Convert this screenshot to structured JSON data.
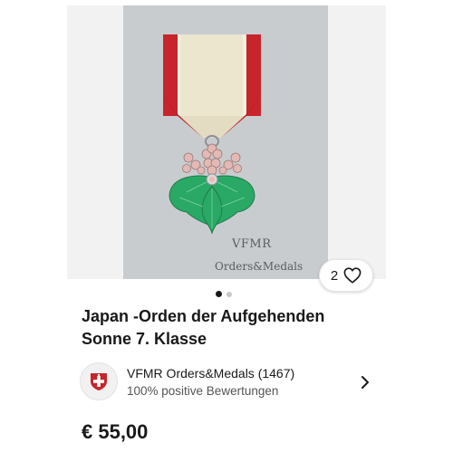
{
  "gallery": {
    "image_alt": "Japan Order of the Rising Sun 7th class medal",
    "watermark_line1": "VFMR",
    "watermark_line2": "Orders&Medals",
    "watch_count": "2",
    "watch_icon": "heart-icon",
    "page_dots": {
      "count": 2,
      "active_index": 0
    }
  },
  "listing": {
    "title_line1": "Japan -Orden der Aufgehenden",
    "title_line2": "Sonne 7. Klasse",
    "price": "€ 55,00"
  },
  "seller": {
    "name": "VFMR Orders&Medals (1467)",
    "feedback": "100% positive Bewertungen",
    "avatar_icon": "shield-cross-icon",
    "chevron_icon": "chevron-right-icon"
  },
  "colors": {
    "ribbon_red": "#c8242b",
    "ribbon_white": "#ece6cf",
    "enamel_green": "#2aa866",
    "petal_pink": "#e4b8b4",
    "avatar_red": "#c8242b"
  }
}
